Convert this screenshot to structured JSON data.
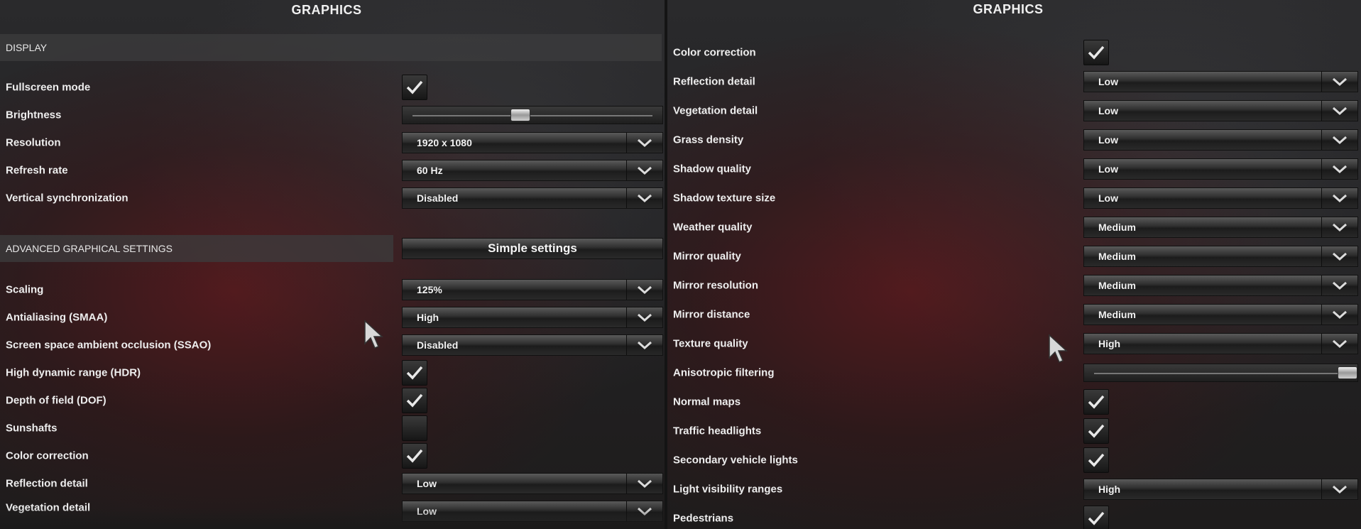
{
  "left_panel": {
    "title": "GRAPHICS",
    "display_section": "DISPLAY",
    "advanced_section": "ADVANCED GRAPHICAL SETTINGS",
    "simple_settings_button": "Simple settings",
    "rows": {
      "fullscreen": {
        "label": "Fullscreen mode",
        "checked": true
      },
      "brightness": {
        "label": "Brightness",
        "level": 0.45
      },
      "resolution": {
        "label": "Resolution",
        "value": "1920 x 1080"
      },
      "refresh": {
        "label": "Refresh rate",
        "value": "60 Hz"
      },
      "vsync": {
        "label": "Vertical synchronization",
        "value": "Disabled"
      },
      "scaling": {
        "label": "Scaling",
        "value": "125%"
      },
      "smaa": {
        "label": "Antialiasing (SMAA)",
        "value": "High"
      },
      "ssao": {
        "label": "Screen space ambient occlusion (SSAO)",
        "value": "Disabled"
      },
      "hdr": {
        "label": "High dynamic range (HDR)",
        "checked": true
      },
      "dof": {
        "label": "Depth of field (DOF)",
        "checked": true
      },
      "sunshafts": {
        "label": "Sunshafts",
        "checked": false
      },
      "color_correction": {
        "label": "Color correction",
        "checked": true
      },
      "reflection": {
        "label": "Reflection detail",
        "value": "Low"
      },
      "vegetation": {
        "label": "Vegetation detail",
        "value": "Low"
      }
    }
  },
  "right_panel": {
    "title": "GRAPHICS",
    "rows": {
      "color_correction": {
        "label": "Color correction",
        "checked": true
      },
      "reflection": {
        "label": "Reflection detail",
        "value": "Low"
      },
      "vegetation": {
        "label": "Vegetation detail",
        "value": "Low"
      },
      "grass": {
        "label": "Grass density",
        "value": "Low"
      },
      "shadow_quality": {
        "label": "Shadow quality",
        "value": "Low"
      },
      "shadow_texture": {
        "label": "Shadow texture size",
        "value": "Low"
      },
      "weather": {
        "label": "Weather quality",
        "value": "Medium"
      },
      "mirror_quality": {
        "label": "Mirror quality",
        "value": "Medium"
      },
      "mirror_resolution": {
        "label": "Mirror resolution",
        "value": "Medium"
      },
      "mirror_distance": {
        "label": "Mirror distance",
        "value": "Medium"
      },
      "texture": {
        "label": "Texture quality",
        "value": "High"
      },
      "anisotropic": {
        "label": "Anisotropic filtering",
        "level": 1.0
      },
      "normal_maps": {
        "label": "Normal maps",
        "checked": true
      },
      "traffic_headlights": {
        "label": "Traffic headlights",
        "checked": true
      },
      "secondary_lights": {
        "label": "Secondary vehicle lights",
        "checked": true
      },
      "light_visibility": {
        "label": "Light visibility ranges",
        "value": "High"
      },
      "pedestrians": {
        "label": "Pedestrians",
        "checked": true
      }
    }
  },
  "colors": {
    "accent_red": "#7a1418",
    "control_text": "#f2f2f2"
  }
}
